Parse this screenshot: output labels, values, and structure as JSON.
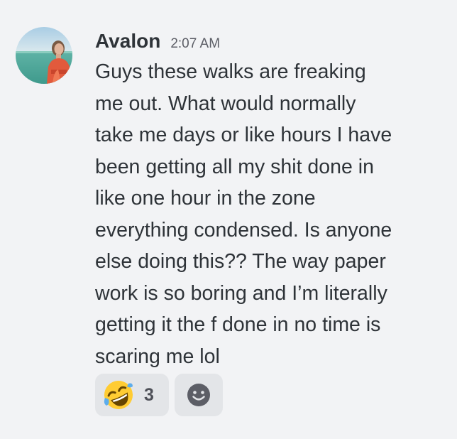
{
  "message": {
    "author": "Avalon",
    "timestamp": "2:07 AM",
    "text": "Guys these walks are freaking\nme out. What would normally\ntake me days or like hours I have\nbeen getting all my shit done in\nlike one hour in the zone\neverything condensed. Is anyone\nelse doing this?? The way paper\nwork is so boring and I’m literally\ngetting it the f done in no time is\nscaring me lol"
  },
  "reactions": [
    {
      "icon": "rolling-on-floor-laughing-emoji",
      "count": "3"
    }
  ],
  "add_reaction": {
    "icon": "smiley-icon"
  },
  "colors": {
    "background": "#f2f3f5",
    "text": "#2e3338",
    "timestamp": "#5c5e66",
    "reaction_bg": "#e3e5e8"
  }
}
